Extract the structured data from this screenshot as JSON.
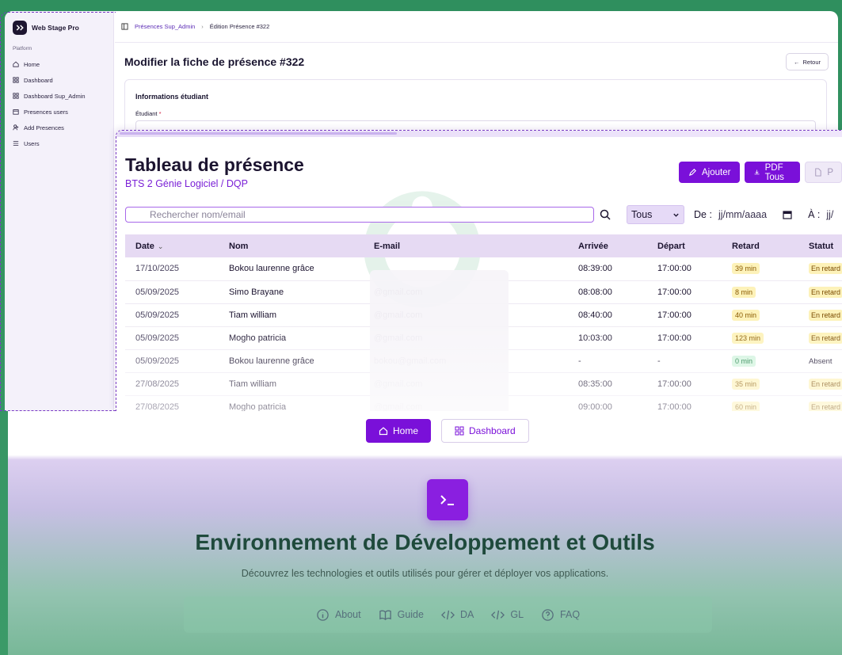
{
  "admin": {
    "brand": "Web Stage Pro",
    "section": "Platform",
    "nav": [
      {
        "label": "Home",
        "icon": "home-icon"
      },
      {
        "label": "Dashboard",
        "icon": "grid-icon"
      },
      {
        "label": "Dashboard Sup_Admin",
        "icon": "grid-icon"
      },
      {
        "label": "Presences users",
        "icon": "calendar-icon"
      },
      {
        "label": "Add Presences",
        "icon": "user-plus-icon"
      },
      {
        "label": "Users",
        "icon": "list-icon"
      }
    ],
    "breadcrumb": {
      "parent": "Présences Sup_Admin",
      "current": "Édition Présence #322"
    },
    "title": "Modifier la fiche de présence #322",
    "back_label": "Retour",
    "card_title": "Informations étudiant",
    "student_label": "Étudiant",
    "required_mark": "*"
  },
  "attendance": {
    "title": "Tableau de présence",
    "subtitle": "BTS 2 Génie Logiciel / DQP",
    "add_label": "Ajouter",
    "pdf_all_label": "PDF Tous",
    "third_label": "P",
    "search_placeholder": "Rechercher nom/email",
    "status_filter": "Tous",
    "from_label": "De :",
    "from_placeholder": "jj/mm/aaaa",
    "to_label": "À :",
    "to_placeholder": "jj/",
    "columns": [
      "Date",
      "Nom",
      "E-mail",
      "Arrivée",
      "Départ",
      "Retard",
      "Statut"
    ],
    "rows": [
      {
        "date": "17/10/2025",
        "name": "Bokou laurenne grâce",
        "email": "",
        "arrival": "08:39:00",
        "departure": "17:00:00",
        "delay": "39 min",
        "status": "En retard"
      },
      {
        "date": "05/09/2025",
        "name": "Simo Brayane",
        "email": "@gmail.com",
        "arrival": "08:08:00",
        "departure": "17:00:00",
        "delay": "8 min",
        "status": "En retard"
      },
      {
        "date": "05/09/2025",
        "name": "Tiam william",
        "email": "@gmail.com",
        "arrival": "08:40:00",
        "departure": "17:00:00",
        "delay": "40 min",
        "status": "En retard"
      },
      {
        "date": "05/09/2025",
        "name": "Mogho patricia",
        "email": "@gmail.com",
        "arrival": "10:03:00",
        "departure": "17:00:00",
        "delay": "123 min",
        "status": "En retard"
      },
      {
        "date": "05/09/2025",
        "name": "Bokou laurenne grâce",
        "email": "bokou@gmail.com",
        "arrival": "-",
        "departure": "-",
        "delay": "0 min",
        "status": "Absent"
      },
      {
        "date": "27/08/2025",
        "name": "Tiam william",
        "email": "@gmail.com",
        "arrival": "08:35:00",
        "departure": "17:00:00",
        "delay": "35 min",
        "status": "En retard"
      },
      {
        "date": "27/08/2025",
        "name": "Mogho patricia",
        "email": "@gmail.com",
        "arrival": "09:00:00",
        "departure": "17:00:00",
        "delay": "60 min",
        "status": "En retard"
      }
    ]
  },
  "landing": {
    "home_label": "Home",
    "dashboard_label": "Dashboard",
    "title": "Environnement de Développement et Outils",
    "subtitle": "Découvrez les technologies et outils utilisés pour gérer et déployer vos applications.",
    "footer_links": [
      {
        "label": "About",
        "icon": "info-icon"
      },
      {
        "label": "Guide",
        "icon": "book-icon"
      },
      {
        "label": "DA",
        "icon": "code-icon"
      },
      {
        "label": "GL",
        "icon": "code-icon"
      },
      {
        "label": "FAQ",
        "icon": "help-icon"
      }
    ],
    "accent": "#7a10d9"
  }
}
